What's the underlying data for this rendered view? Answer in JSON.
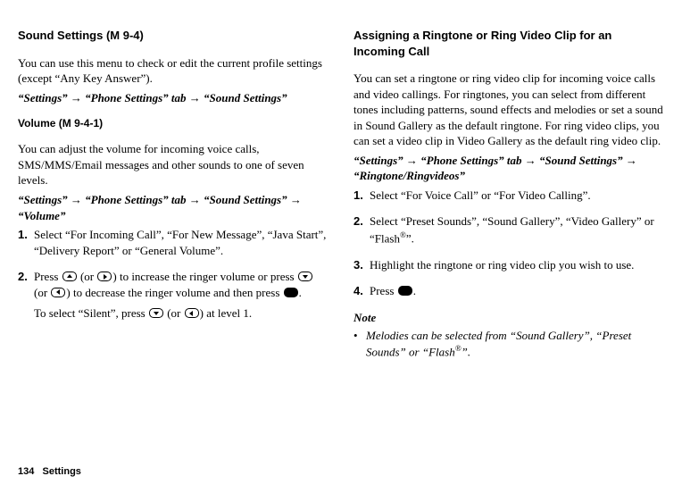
{
  "left": {
    "h1_title": "Sound Settings",
    "h1_code": " (M 9-4)",
    "p1": "You can use this menu to check or edit the current profile settings (except “Any Key Answer”).",
    "nav1_a": "“Settings”",
    "nav1_b": "“Phone Settings” tab",
    "nav1_c": "“Sound Settings”",
    "h2_title": "Volume",
    "h2_code": " (M 9-4-1)",
    "p2": "You can adjust the volume for incoming voice calls, SMS/MMS/Email messages and other sounds to one of seven levels.",
    "nav2_a": "“Settings”",
    "nav2_b": "“Phone Settings” tab",
    "nav2_c": "“Sound Settings”",
    "nav2_d": "“Volume”",
    "step1": "Select “For Incoming Call”, “For New Message”, “Java Start”, “Delivery Report” or “General Volume”.",
    "step2a_pre": "Press ",
    "step2a_mid1": " (or ",
    "step2a_mid2": ") to increase the ringer volume or press ",
    "step2a_mid3": " (or ",
    "step2a_mid4": ") to decrease the ringer volume and then press ",
    "step2a_end": ".",
    "step2b_pre": "To select “Silent”, press ",
    "step2b_mid1": " (or ",
    "step2b_end": ") at level 1."
  },
  "right": {
    "h1": "Assigning a Ringtone or Ring Video Clip for an Incoming Call",
    "p1": "You can set a ringtone or ring video clip for incoming voice calls and video callings. For ringtones, you can select from different tones including patterns, sound effects and melodies or set a sound in Sound Gallery as the default ringtone. For ring video clips, you can set a video clip in Video Gallery as the default ring video clip.",
    "nav_a": "“Settings”",
    "nav_b": "“Phone Settings” tab",
    "nav_c": "“Sound Settings”",
    "nav_d": "“Ringtone/Ringvideos”",
    "step1": "Select “For Voice Call” or “For Video Calling”.",
    "step2_pre": "Select “Preset Sounds”, “Sound Gallery”, “Video Gallery” or “Flash",
    "step2_post": "”.",
    "step3": "Highlight the ringtone or ring video clip you wish to use.",
    "step4_pre": "Press ",
    "step4_post": ".",
    "note_heading": "Note",
    "note_bullet": "•",
    "note_pre": "Melodies can be selected from “Sound Gallery”, “Preset Sounds” or “Flash",
    "note_post": "”."
  },
  "numbers": {
    "n1": "1.",
    "n2": "2.",
    "n3": "3.",
    "n4": "4."
  },
  "arrow": " → ",
  "reg": "®",
  "footer": {
    "page": "134",
    "section": "Settings"
  }
}
